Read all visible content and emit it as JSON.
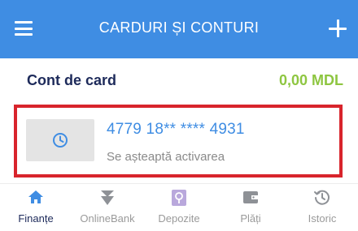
{
  "header": {
    "title": "CARDURI ȘI CONTURI",
    "menu_icon": "menu-icon",
    "add_icon": "plus-icon",
    "background_color": "#3f8de3"
  },
  "section": {
    "title": "Cont de card",
    "balance": "0,00 MDL",
    "balance_color": "#8ec641"
  },
  "card": {
    "number": "4779 18** **** 4931",
    "status": "Se așteaptă activarea",
    "thumb_icon": "clock-icon",
    "highlight_color": "#d8242c"
  },
  "bottom_nav": {
    "items": [
      {
        "label": "Finanțe",
        "icon": "home-icon",
        "active": true
      },
      {
        "label": "OnlineBank",
        "icon": "transfer-icon",
        "active": false
      },
      {
        "label": "Depozite",
        "icon": "deposit-icon",
        "active": false
      },
      {
        "label": "Plăți",
        "icon": "wallet-icon",
        "active": false
      },
      {
        "label": "Istoric",
        "icon": "history-icon",
        "active": false
      }
    ]
  }
}
